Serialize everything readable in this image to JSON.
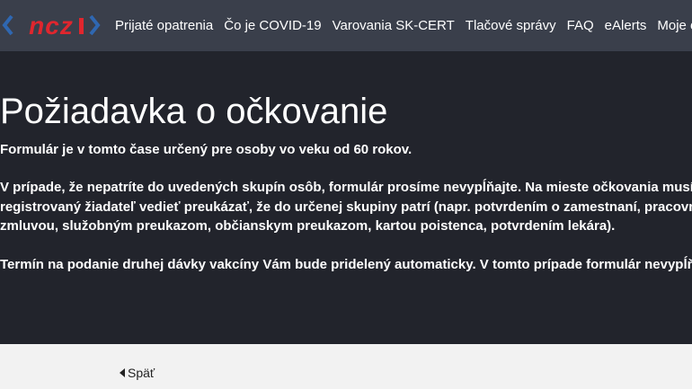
{
  "header": {
    "logo_text": "NCZI",
    "logo_colors": {
      "brackets": "#2f67b1",
      "text": "#e0262e"
    },
    "nav": [
      {
        "label": "Prijaté opatrenia"
      },
      {
        "label": "Čo je COVID-19"
      },
      {
        "label": "Varovania SK-CERT"
      },
      {
        "label": "Tlačové správy"
      },
      {
        "label": "FAQ"
      },
      {
        "label": "eAlerts"
      },
      {
        "label": "Moje ezdravie"
      }
    ]
  },
  "main": {
    "title": "Požiadavka o očkovanie",
    "paragraphs": [
      [
        "Formulár je v tomto čase určený pre osoby vo veku od 60 rokov."
      ],
      [
        "V prípade, že nepatríte do uvedených skupín osôb, formulár prosíme nevypĺňajte. Na mieste očkovania musí",
        "registrovaný žiadateľ vedieť preukázať, že do určenej skupiny patrí (napr. potvrdením o zamestnaní, pracovnou",
        "zmluvou, služobným preukazom, občianskym preukazom, kartou poistenca, potvrdením lekára)."
      ],
      [
        "Termín na podanie druhej dávky vakcíny Vám bude pridelený automaticky. V tomto prípade formulár nevypĺňajte."
      ]
    ]
  },
  "footer": {
    "back_label": "Späť"
  },
  "colors": {
    "navbar_bg": "#3a3f4b",
    "hero_bg": "#22242c",
    "footer_bg": "#f2f2f2"
  }
}
